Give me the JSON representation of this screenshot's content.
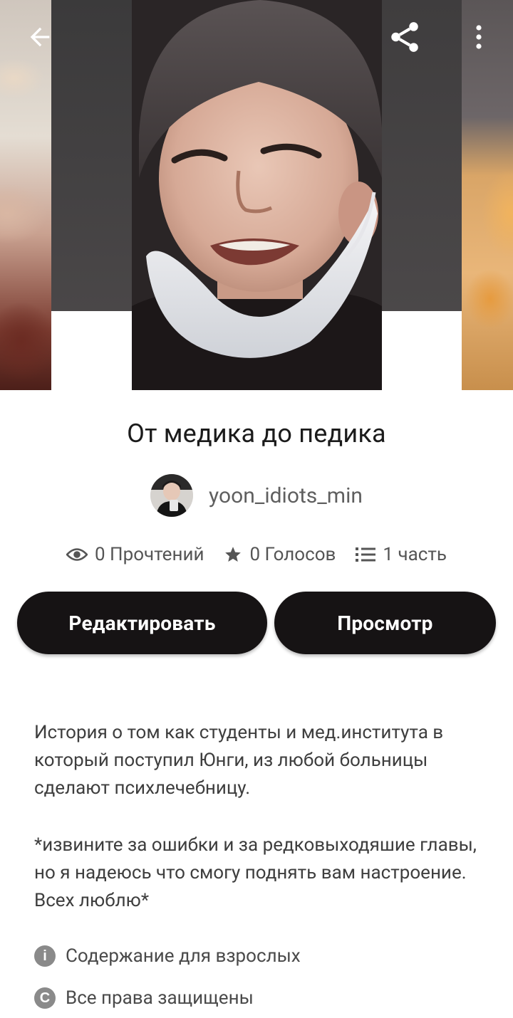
{
  "header": {
    "back_icon": "arrow-left-icon",
    "share_icon": "share-icon",
    "more_icon": "more-vertical-icon"
  },
  "story": {
    "title": "От медика до педика",
    "author": "yoon_idiots_min"
  },
  "stats": {
    "reads": "0 Прочтений",
    "votes": "0 Голосов",
    "parts": "1 часть"
  },
  "actions": {
    "edit_label": "Редактировать",
    "view_label": "Просмотр"
  },
  "description": {
    "paragraph1": "История о том как студенты и мед.института в который поступил Юнги, из любой больницы сделают психлечебницу.",
    "paragraph2": "*извините за ошибки и за редковыходяшие главы, но я надеюсь что смогу поднять вам настроение. Всех люблю*"
  },
  "meta": {
    "mature_label": "Содержание для взрослых",
    "copyright_label": "Все права защищены"
  },
  "colors": {
    "button_bg": "#161314",
    "button_text": "#ffffff",
    "text_muted": "#5f5f5f"
  }
}
